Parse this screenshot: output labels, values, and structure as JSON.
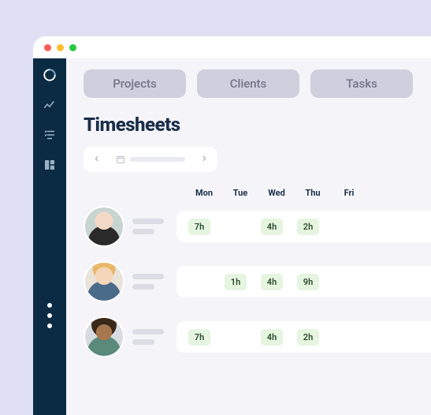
{
  "page_title": "Timesheets",
  "tabs": [
    {
      "label": "Projects"
    },
    {
      "label": "Clients"
    },
    {
      "label": "Tasks"
    }
  ],
  "day_headers": [
    "Mon",
    "Tue",
    "Wed",
    "Thu",
    "Fri"
  ],
  "rows": [
    {
      "hours": [
        "7h",
        "",
        "4h",
        "2h",
        ""
      ]
    },
    {
      "hours": [
        "",
        "1h",
        "4h",
        "9h",
        ""
      ]
    },
    {
      "hours": [
        "7h",
        "",
        "4h",
        "2h",
        ""
      ]
    }
  ]
}
